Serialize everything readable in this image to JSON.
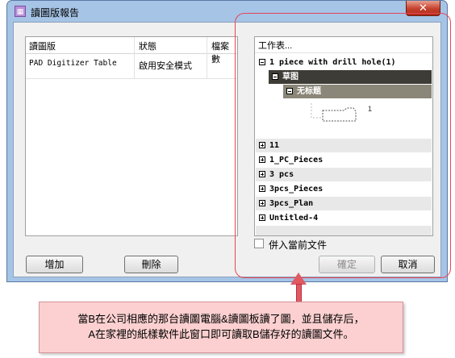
{
  "window": {
    "title": "讀圖版報告",
    "close_glyph": "✕"
  },
  "table": {
    "headers": [
      "讀圖版",
      "狀態",
      "檔案數"
    ],
    "rows": [
      {
        "device": "PAD Digitizer Table",
        "status": "啟用安全模式",
        "files": ""
      }
    ]
  },
  "left_buttons": {
    "add": "增加",
    "delete": "刪除"
  },
  "tree": {
    "header": "工作表...",
    "root": "1 piece with drill hole(1)",
    "child": "草图",
    "grandchild": "无标题",
    "thumb_label": "1",
    "items": [
      "11",
      "1_PC_Pieces",
      "3 pcs",
      "3pcs_Pieces",
      "3pcs_Plan",
      "Untitled-4"
    ]
  },
  "merge_checkbox": {
    "label": "併入當前文件",
    "checked": false
  },
  "right_buttons": {
    "ok": "確定",
    "cancel": "取消"
  },
  "callout": {
    "line1": "當B在公司相應的那台讀圖電腦&讀圖板讀了圖，並且儲存后，",
    "line2": "A在家裡的紙樣軟件此窗口即可讀取B儲存好的讀圖文件。"
  },
  "colors": {
    "highlight": "#e64554",
    "callout_bg": "#fcd0d0",
    "selected_dark": "#3e3c36",
    "selected_mid": "#8a8678"
  }
}
